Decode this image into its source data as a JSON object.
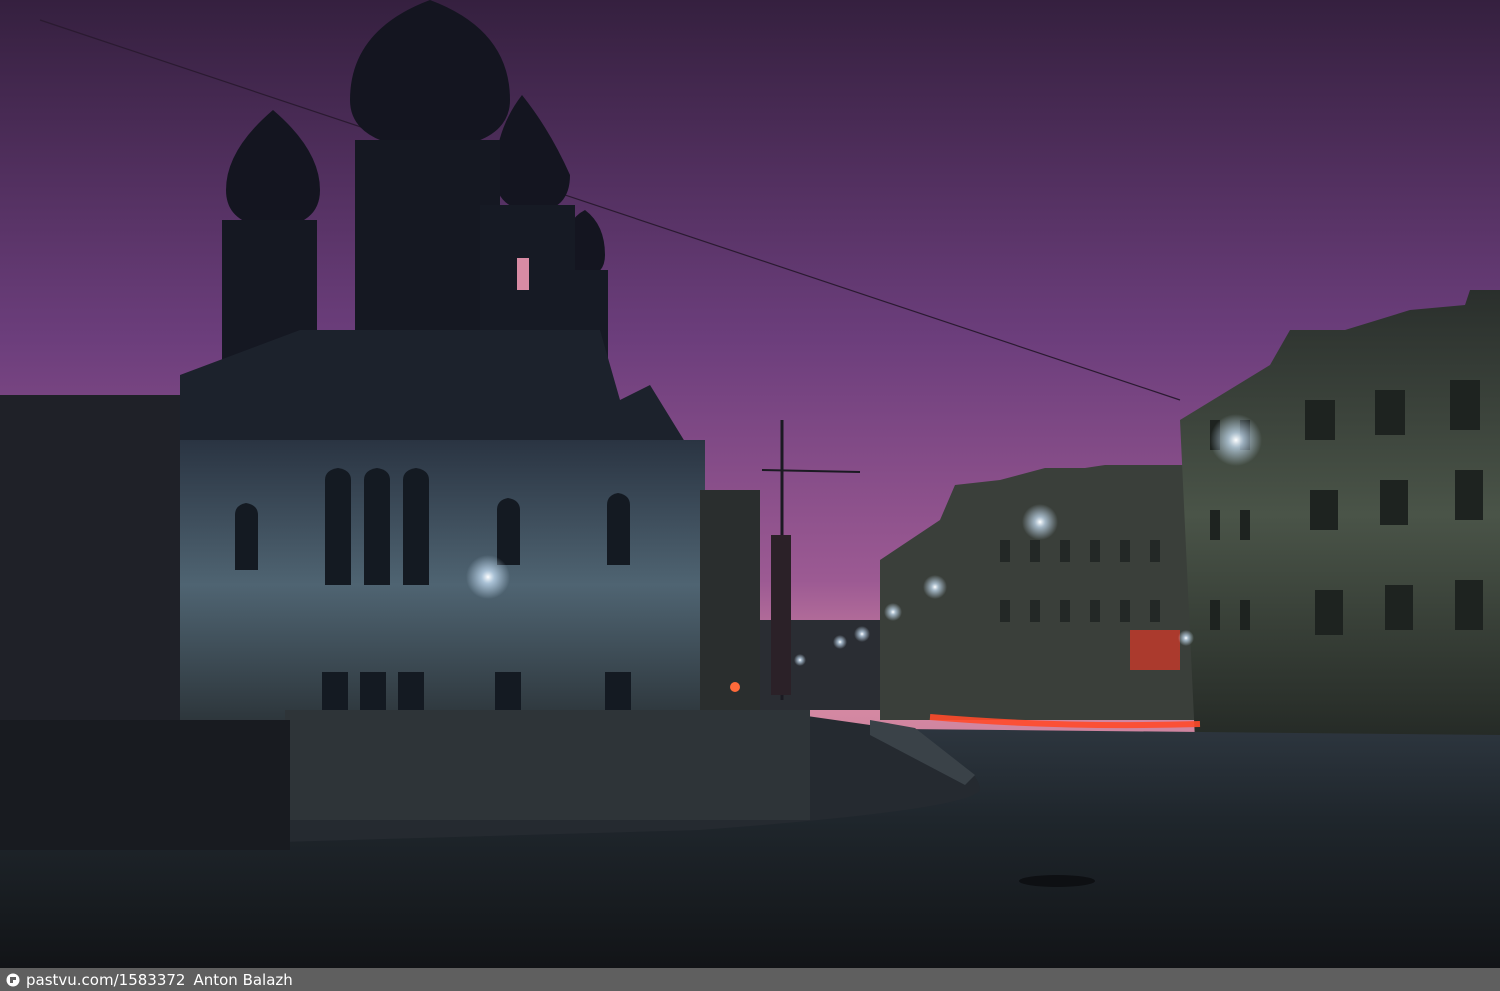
{
  "scene": {
    "subject": "church-silhouette-at-dusk-street-corner",
    "colors": {
      "sky_top": "#3a2347",
      "sky_mid": "#7a4a8a",
      "sky_horizon": "#d98aa6",
      "building_shadow": "#151a22",
      "facade_lit": "#5d7482",
      "road": "#1e2328",
      "street_light": "#e8f4ff",
      "tail_light": "#ff3a2a"
    }
  },
  "watermark": {
    "icon": "pastvu-logo-icon",
    "url_text": "pastvu.com/1583372",
    "author": "Anton Balazh"
  }
}
